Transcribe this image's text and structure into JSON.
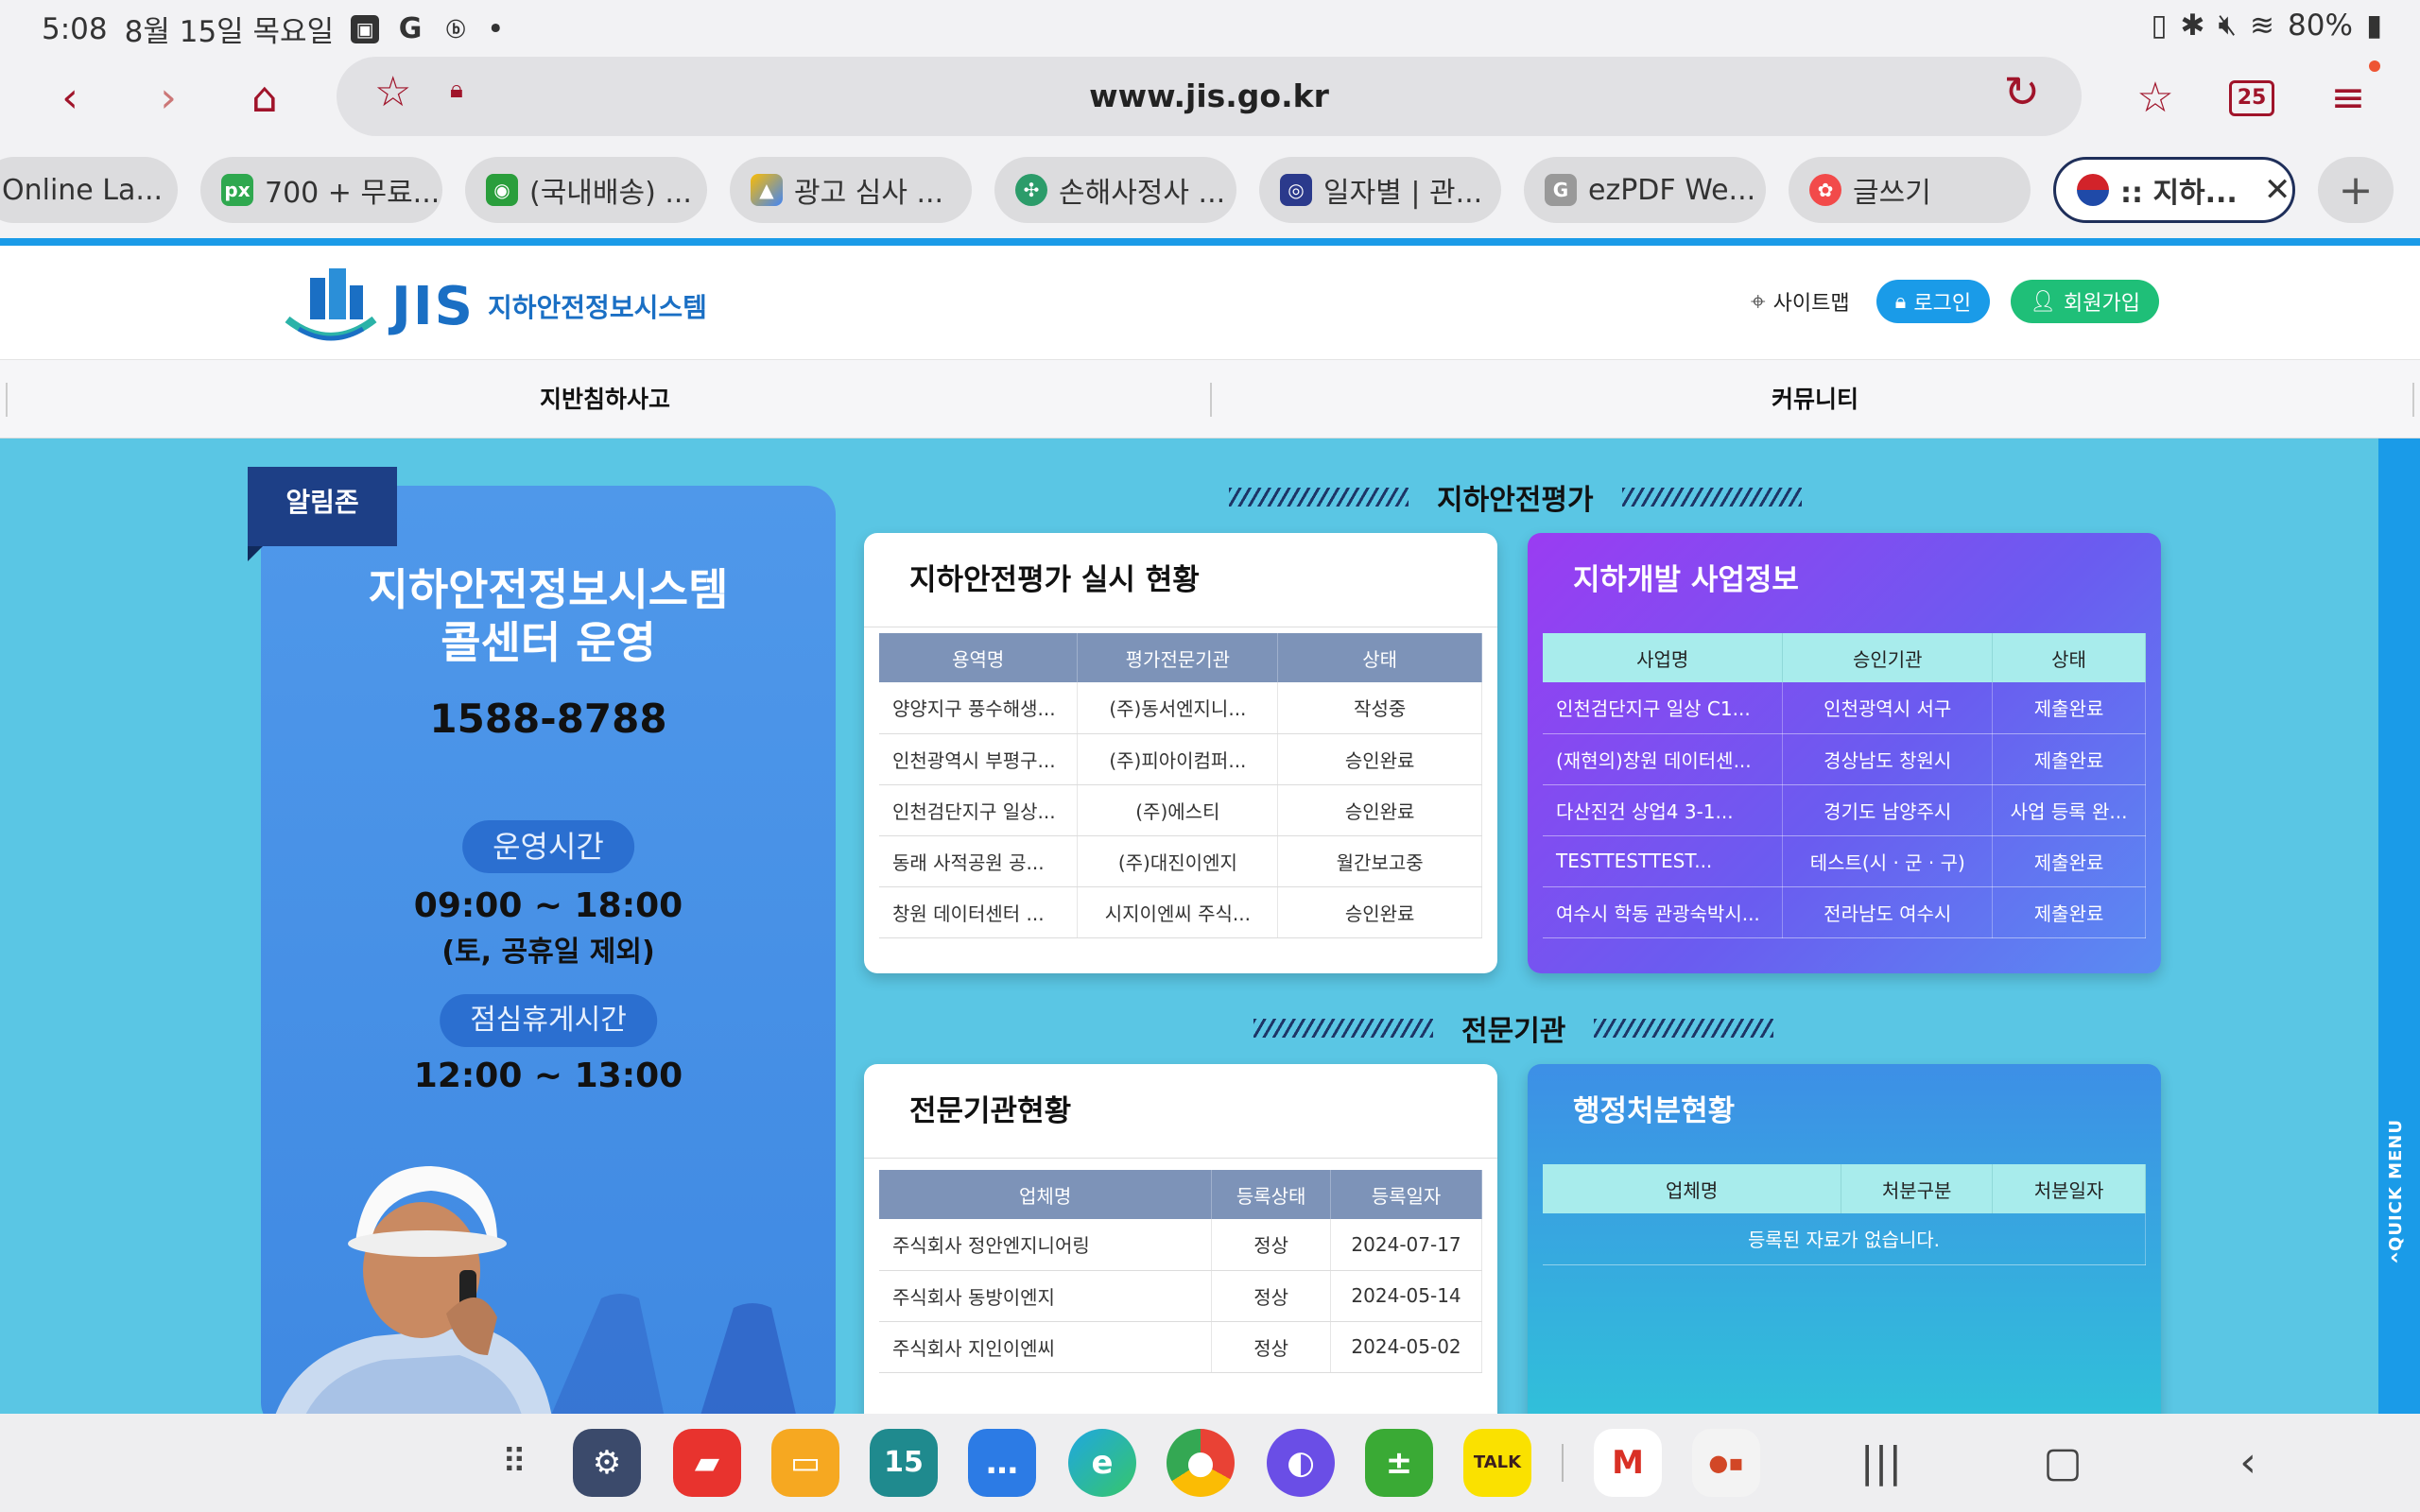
{
  "status_bar": {
    "time": "5:08",
    "date": "8월 15일 목요일",
    "battery": "80%"
  },
  "browser": {
    "url": "www.jis.go.kr",
    "tab_count": "25",
    "tabs": [
      {
        "title": "Online La...",
        "icon": "page-icon"
      },
      {
        "title": "700 + 무료...",
        "icon": "px-icon"
      },
      {
        "title": "(국내배송) ...",
        "icon": "shop-icon"
      },
      {
        "title": "광고 심사 ...",
        "icon": "google-ads-icon"
      },
      {
        "title": "손해사정사 ...",
        "icon": "clover-icon"
      },
      {
        "title": "일자별 | 관...",
        "icon": "seal-icon"
      },
      {
        "title": "ezPDF We...",
        "icon": "g-icon"
      },
      {
        "title": "글쓰기",
        "icon": "flower-icon"
      },
      {
        "title": ":: 지하...",
        "icon": "taeguk-icon"
      }
    ]
  },
  "site": {
    "logo_text": "JIS",
    "logo_subtitle": "지하안전정보시스템",
    "header_links": {
      "sitemap": "사이트맵",
      "login": "로그인",
      "signup": "회원가입"
    },
    "nav": [
      "지반침하사고",
      "커뮤니티"
    ],
    "quick_menu": "QUICK MENU"
  },
  "call_center": {
    "badge": "알림존",
    "title_line1": "지하안전정보시스템",
    "title_line2": "콜센터 운영",
    "phone": "1588-8788",
    "hours_label": "운영시간",
    "hours": "09:00 ~ 18:00",
    "hours_note": "(토, 공휴일 제외)",
    "lunch_label": "점심휴게시간",
    "lunch": "12:00 ~ 13:00"
  },
  "sections": {
    "evaluation": "지하안전평가",
    "agency": "전문기관"
  },
  "eval_status": {
    "title": "지하안전평가 실시 현황",
    "columns": [
      "용역명",
      "평가전문기관",
      "상태"
    ],
    "rows": [
      [
        "양양지구 풍수해생...",
        "(주)동서엔지니...",
        "작성중"
      ],
      [
        "인천광역시 부평구...",
        "(주)피아이컴퍼...",
        "승인완료"
      ],
      [
        "인천검단지구 일상...",
        "(주)에스티",
        "승인완료"
      ],
      [
        "동래 사적공원 공...",
        "(주)대진이엔지",
        "월간보고중"
      ],
      [
        "창원 데이터센터 ...",
        "시지이엔씨 주식...",
        "승인완료"
      ]
    ]
  },
  "dev_info": {
    "title": "지하개발 사업정보",
    "columns": [
      "사업명",
      "승인기관",
      "상태"
    ],
    "rows": [
      [
        "인천검단지구 일상 C1...",
        "인천광역시 서구",
        "제출완료"
      ],
      [
        "(재현의)창원 데이터센...",
        "경상남도 창원시",
        "제출완료"
      ],
      [
        "다산진건 상업4 3-1...",
        "경기도 남양주시",
        "사업 등록 완..."
      ],
      [
        "TESTTESTTEST...",
        "테스트(시 · 군 · 구)",
        "제출완료"
      ],
      [
        "여수시 학동 관광숙박시...",
        "전라남도 여수시",
        "제출완료"
      ]
    ]
  },
  "agency_status": {
    "title": "전문기관현황",
    "columns": [
      "업체명",
      "등록상태",
      "등록일자"
    ],
    "rows": [
      [
        "주식회사 정안엔지니어링",
        "정상",
        "2024-07-17"
      ],
      [
        "주식회사 동방이엔지",
        "정상",
        "2024-05-14"
      ],
      [
        "주식회사 지인이엔씨",
        "정상",
        "2024-05-02"
      ]
    ]
  },
  "admin_actions": {
    "title": "행정처분현황",
    "columns": [
      "업체명",
      "처분구분",
      "처분일자"
    ],
    "empty": "등록된 자료가 없습니다."
  },
  "dock": {
    "apps": [
      "settings-app",
      "notes-app",
      "files-app",
      "calendar-app",
      "messages-app",
      "edge-app",
      "chrome-app",
      "internet-app",
      "calculator-app",
      "kakaotalk-app",
      "gmail-app",
      "office-app"
    ],
    "calendar_day": "15",
    "talk_label": "TALK"
  }
}
